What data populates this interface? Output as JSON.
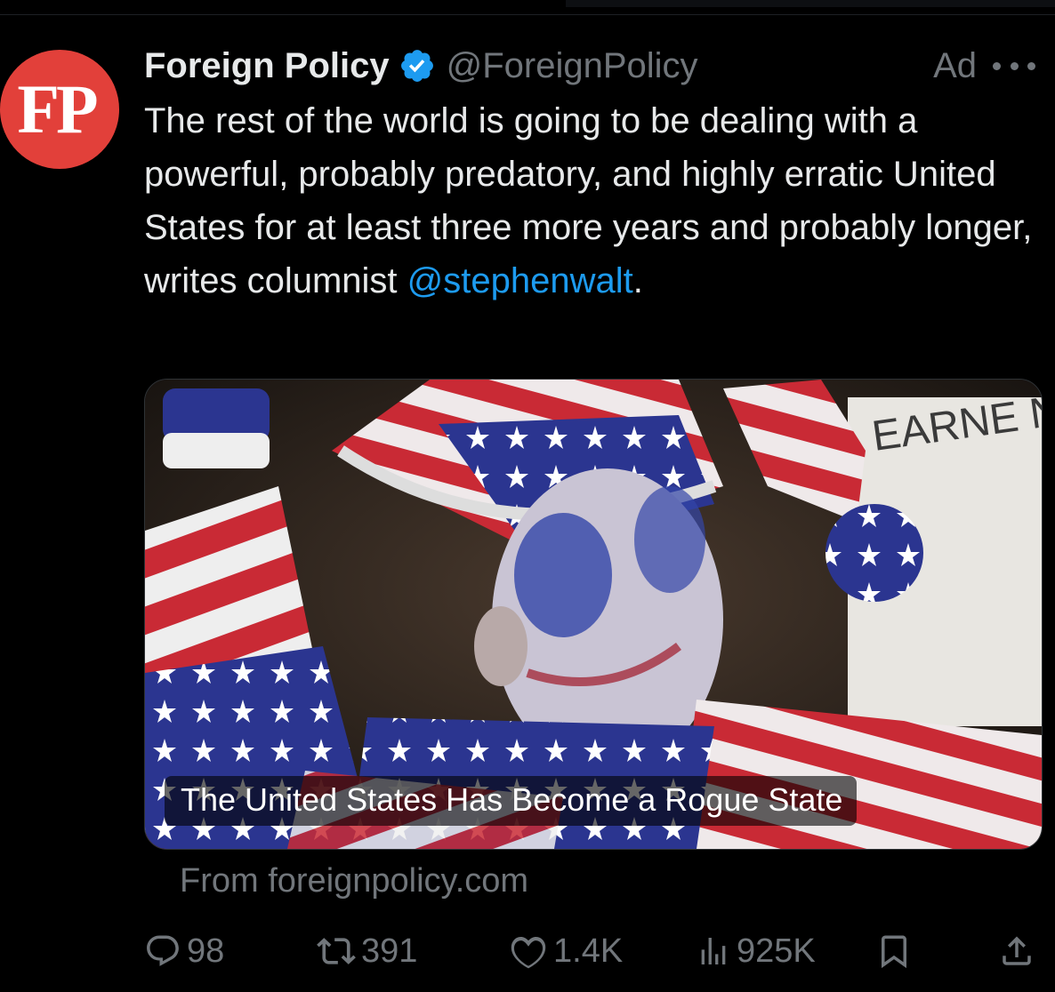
{
  "account": {
    "avatar_text": "FP",
    "display_name": "Foreign Policy",
    "handle": "@ForeignPolicy",
    "ad_label": "Ad"
  },
  "tweet": {
    "text": "The rest of the world is going to be dealing with a powerful, probably predatory, and highly erratic United States for at least three more years and probably longer, writes columnist ",
    "mention": "@stephenwalt",
    "trailing": "."
  },
  "card": {
    "title": "The United States Has Become a Rogue State",
    "source": "From foreignpolicy.com",
    "image_sign_text": "EARNE N PONZI"
  },
  "actions": {
    "replies": "98",
    "reposts": "391",
    "likes": "1.4K",
    "views": "925K"
  },
  "icons": {
    "verified": "verified-badge-icon",
    "more": "more-dots-icon",
    "reply": "reply-icon",
    "repost": "repost-icon",
    "like": "heart-icon",
    "views": "views-bar-icon",
    "bookmark": "bookmark-icon",
    "share": "share-icon"
  },
  "colors": {
    "background": "#000000",
    "text": "#e7e9ea",
    "secondary": "#71767b",
    "link": "#1d9bf0",
    "avatar": "#e2403a"
  }
}
